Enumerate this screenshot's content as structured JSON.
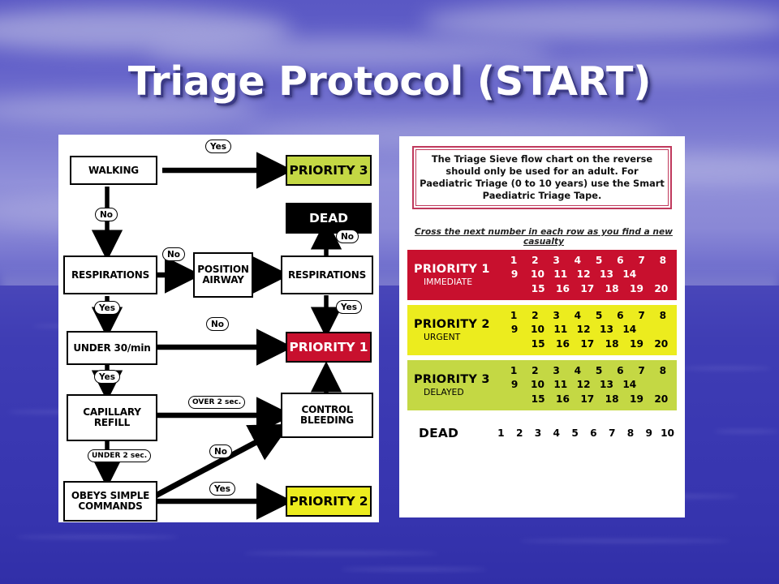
{
  "slide": {
    "title": "Triage Protocol (START)"
  },
  "background": {
    "sky_color": "#6361c9",
    "sea_color": "#3a38b2"
  },
  "flowchart": {
    "nodes": [
      {
        "id": "walking",
        "label": "WALKING"
      },
      {
        "id": "respirations1",
        "label": "RESPIRATIONS"
      },
      {
        "id": "position",
        "label": "POSITION\nAIRWAY"
      },
      {
        "id": "respirations2",
        "label": "RESPIRATIONS"
      },
      {
        "id": "under30",
        "label": "UNDER 30/min"
      },
      {
        "id": "capillary",
        "label": "CAPILLARY\nREFILL"
      },
      {
        "id": "obeys",
        "label": "OBEYS SIMPLE\nCOMMANDS"
      },
      {
        "id": "control",
        "label": "CONTROL\nBLEEDING"
      }
    ],
    "outcomes": [
      {
        "id": "priority3",
        "label": "PRIORITY 3",
        "bg": "#c4d844",
        "fg": "#000000"
      },
      {
        "id": "dead",
        "label": "DEAD",
        "bg": "#000000",
        "fg": "#ffffff"
      },
      {
        "id": "priority1",
        "label": "PRIORITY 1",
        "bg": "#c8102e",
        "fg": "#ffffff"
      },
      {
        "id": "priority2",
        "label": "PRIORITY 2",
        "bg": "#ecec1e",
        "fg": "#000000"
      }
    ],
    "edge_labels": {
      "walking_yes": "Yes",
      "walking_no": "No",
      "resp1_no": "No",
      "resp1_yes": "Yes",
      "resp2_no": "No",
      "resp2_yes": "Yes",
      "under30_no": "No",
      "under30_yes": "Yes",
      "capillary_over": "OVER 2 sec.",
      "capillary_under": "UNDER 2 sec.",
      "obeys_no": "No",
      "obeys_yes": "Yes"
    }
  },
  "card": {
    "notice": "The Triage Sieve flow chart on the reverse should only be used for an adult. For Paediatric Triage (0 to 10 years) use the Smart Paediatric Triage Tape.",
    "cross_note": "Cross the next number in each row as you find a new casualty",
    "rows": [
      {
        "id": "priority1",
        "name": "PRIORITY  1",
        "sub": "IMMEDIATE",
        "bg": "#c8102e",
        "fg": "#ffffff",
        "numbers_1": [
          "1",
          "2",
          "3",
          "4",
          "5",
          "6",
          "7",
          "8"
        ],
        "numbers_2": [
          "9",
          "10",
          "11",
          "12",
          "13",
          "14"
        ],
        "numbers_3": [
          "15",
          "16",
          "17",
          "18",
          "19",
          "20"
        ]
      },
      {
        "id": "priority2",
        "name": "PRIORITY  2",
        "sub": "URGENT",
        "bg": "#ecec1e",
        "fg": "#000000",
        "numbers_1": [
          "1",
          "2",
          "3",
          "4",
          "5",
          "6",
          "7",
          "8"
        ],
        "numbers_2": [
          "9",
          "10",
          "11",
          "12",
          "13",
          "14"
        ],
        "numbers_3": [
          "15",
          "16",
          "17",
          "18",
          "19",
          "20"
        ]
      },
      {
        "id": "priority3",
        "name": "PRIORITY  3",
        "sub": "DELAYED",
        "bg": "#c4d844",
        "fg": "#000000",
        "numbers_1": [
          "1",
          "2",
          "3",
          "4",
          "5",
          "6",
          "7",
          "8"
        ],
        "numbers_2": [
          "9",
          "10",
          "11",
          "12",
          "13",
          "14"
        ],
        "numbers_3": [
          "15",
          "16",
          "17",
          "18",
          "19",
          "20"
        ]
      }
    ],
    "dead": {
      "name": "DEAD",
      "numbers": [
        "1",
        "2",
        "3",
        "4",
        "5",
        "6",
        "7",
        "8",
        "9",
        "10"
      ]
    }
  }
}
